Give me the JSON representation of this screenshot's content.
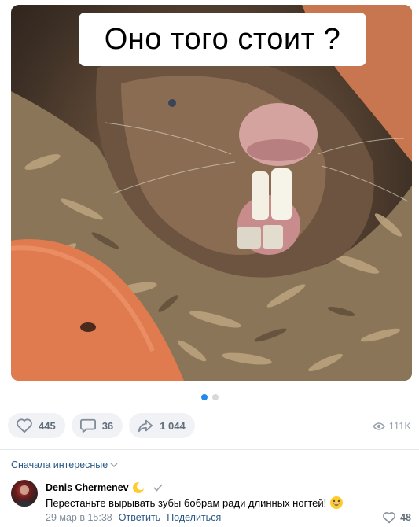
{
  "post": {
    "caption": "Оно того стоит ?",
    "carousel": {
      "count": 2,
      "active": 0
    }
  },
  "actions": {
    "likes": "445",
    "comments": "36",
    "shares": "1 044",
    "views": "111K"
  },
  "comments_section": {
    "sort_label": "Сначала интересные",
    "comment": {
      "author": "Denis Chermenev",
      "text": "Перестаньте вырывать зубы бобрам ради длинных ногтей!",
      "date": "29 мар в 15:38",
      "reply_label": "Ответить",
      "share_label": "Поделиться",
      "likes": "48"
    }
  },
  "colors": {
    "accent": "#2688eb",
    "link": "#2a5885",
    "pill_bg": "#f0f2f5",
    "muted": "#99a2ad"
  },
  "icons": {
    "like": "heart-icon",
    "comment": "comment-icon",
    "share": "share-icon",
    "views": "eye-icon",
    "sort": "chevron-down-icon",
    "verified": "check-icon",
    "emoji_badge": "moon-emoji-icon",
    "emoji_grin": "grin-emoji-icon"
  }
}
